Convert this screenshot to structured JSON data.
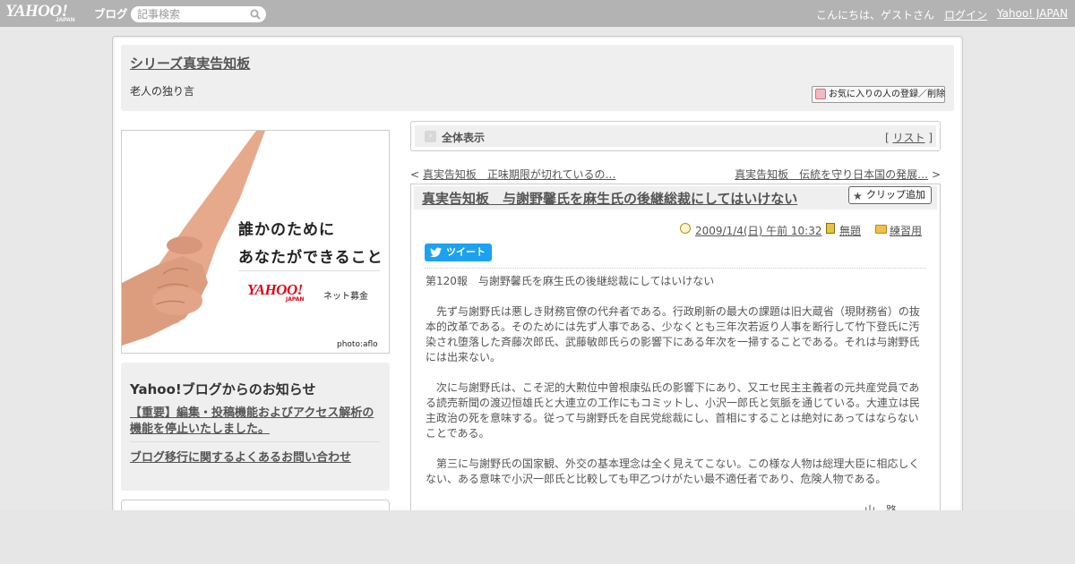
{
  "topbar": {
    "logo_text": "YAHOO!",
    "logo_sub": "JAPAN",
    "logo_service": "ブログ",
    "search_placeholder": "記事検索",
    "greeting": "こんにちは、ゲストさん",
    "login_label": "ログイン",
    "yahoo_japan_label": "Yahoo! JAPAN"
  },
  "blog": {
    "title": "シリーズ真実告知板",
    "description": "老人の独り言",
    "fav_button_label": "お気に入りの人の登録／削除"
  },
  "ad": {
    "line1": "誰かのために",
    "line2": "あなたができること",
    "brand": "YAHOO!",
    "brand_sub": "JAPAN",
    "service": "ネット募金",
    "credit": "photo:aflo"
  },
  "notice": {
    "title": "Yahoo!ブログからのお知らせ",
    "items": [
      "【重要】編集・投稿機能およびアクセス解析の機能を停止いたしました。",
      "ブログ移行に関するよくあるお問い合わせ"
    ]
  },
  "viewbar": {
    "label": "全体表示",
    "list_open": "[ ",
    "list_label": "リスト",
    "list_close": " ]"
  },
  "nav": {
    "prev_arrow": "< ",
    "prev_label": "真実告知板　正味期限が切れているの…",
    "next_label": "真実告知板　伝統を守り日本国の発展…",
    "next_arrow": " >"
  },
  "article": {
    "title": "真実告知板　与謝野馨氏を麻生氏の後継総裁にしてはいけない",
    "clip_label": "クリップ追加",
    "date": "2009/1/4(日) 午前 10:32",
    "theme": "無題",
    "category": "練習用",
    "tweet_label": "ツイート",
    "paragraphs": [
      "第120報　与謝野馨氏を麻生氏の後継総裁にしてはいけない",
      "　先ず与謝野氏は悪しき財務官僚の代弁者である。行政刷新の最大の課題は旧大蔵省（現財務省）の抜本的改革である。そのためには先ず人事である、少なくとも三年次若返り人事を断行して竹下登氏に汚染され堕落した斉藤次郎氏、武藤敏郎氏らの影響下にある年次を一掃することである。それは与謝野氏には出来ない。",
      "　次に与謝野氏は、こそ泥的大勲位中曽根康弘氏の影響下にあり、又エセ民主主義者の元共産党員である読売新聞の渡辺恒雄氏と大連立の工作にもコミットし、小沢一郎氏と気脈を通じている。大連立は民主政治の死を意味する。従って与謝野氏を自民党総裁にし、首相にすることは絶対にあってはならないことである。",
      "　第三に与謝野氏の国家観、外交の基本理念は全く見えてこない。この様な人物は総理大臣に相応しくない、ある意味で小沢一郎氏と比較しても甲乙つけがたい最不適任者であり、危険人物である。"
    ],
    "signature": "山　路"
  },
  "colors": {
    "topbar": "#b3b3b3",
    "panel": "#efefef",
    "tweet": "#1da1f2",
    "ad_brand": "#e60012"
  }
}
